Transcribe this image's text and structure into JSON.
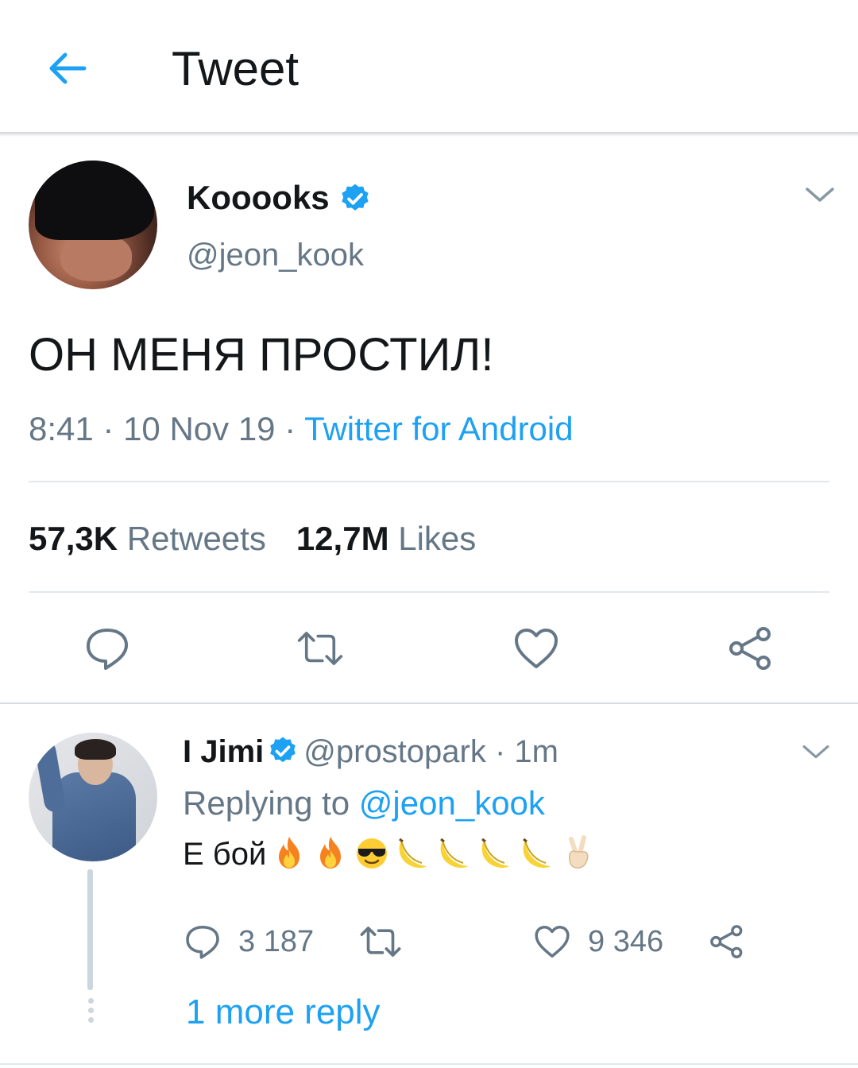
{
  "header": {
    "title": "Tweet"
  },
  "tweet": {
    "author_name": "Kooooks",
    "author_handle": "@jeon_kook",
    "text": "ОН МЕНЯ ПРОСТИЛ!",
    "time": "8:41",
    "date": "10 Nov 19",
    "source": "Twitter for Android",
    "retweets_count": "57,3K",
    "retweets_label": "Retweets",
    "likes_count": "12,7M",
    "likes_label": "Likes"
  },
  "reply": {
    "author_name": "I Jimi",
    "author_handle": "@prostopark",
    "time": "1m",
    "replying_prefix": "Replying to",
    "replying_to": "@jeon_kook",
    "text": "Е бой",
    "emojis": [
      "fire",
      "fire",
      "sunglasses-face",
      "banana",
      "banana",
      "banana",
      "banana",
      "victory-hand"
    ],
    "reply_count": "3 187",
    "like_count": "9 346"
  },
  "more_replies": "1 more reply",
  "colors": {
    "accent": "#1da1f2",
    "secondary_text": "#657786",
    "text": "#14171a",
    "divider": "#e1e8ed"
  }
}
